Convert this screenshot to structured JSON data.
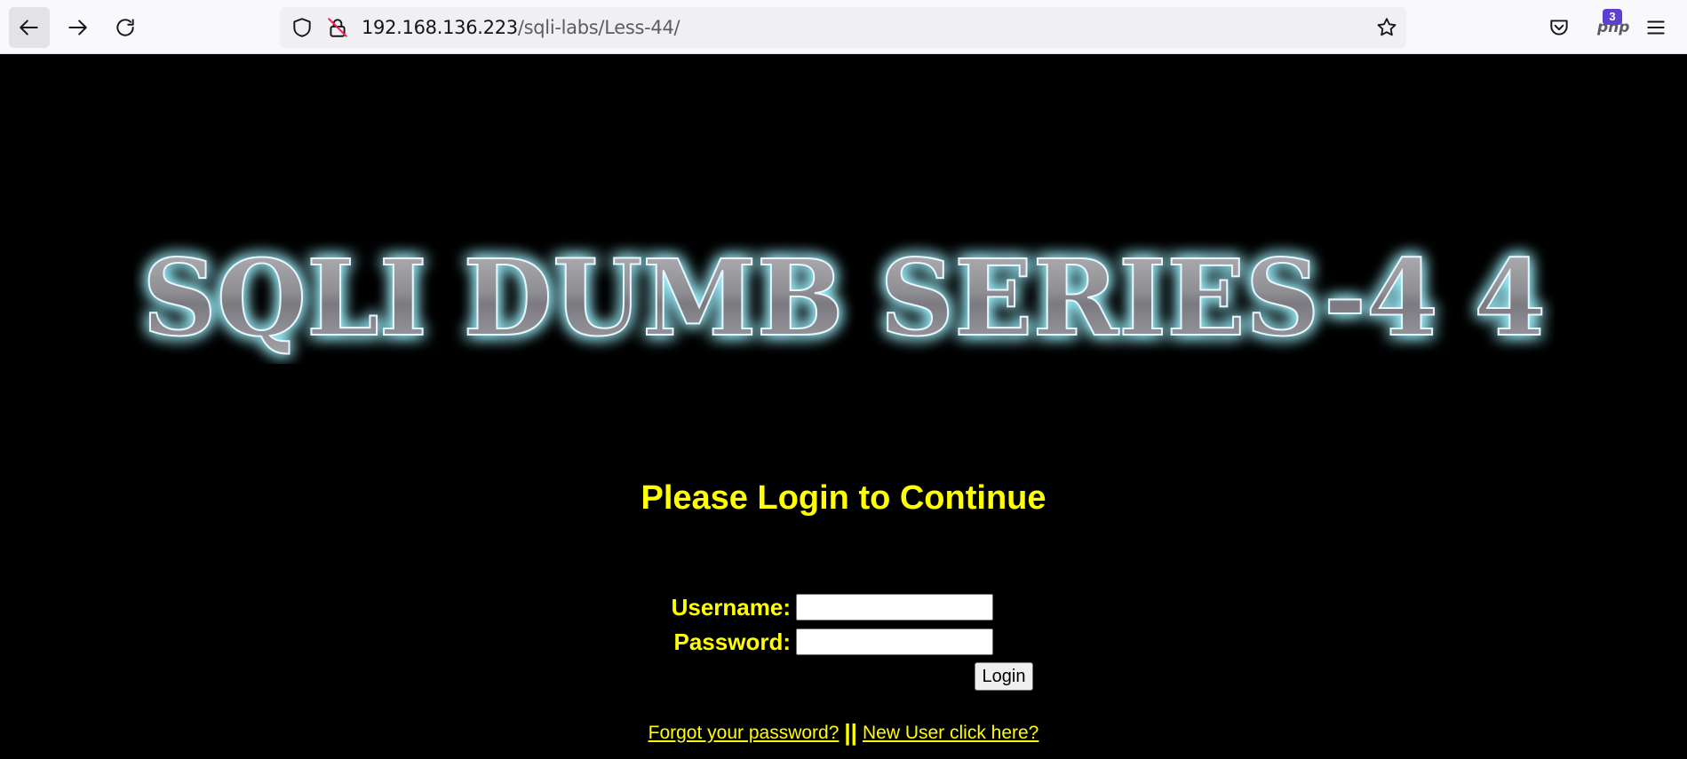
{
  "browser": {
    "url_host": "192.168.136.223",
    "url_path": "/sqli-labs/Less-44/",
    "extension_badge": "3",
    "extension_label": "php"
  },
  "page": {
    "banner_text": "SQLI DUMB SERIES-4 4",
    "heading": "Please Login to Continue",
    "username_label": "Username:",
    "password_label": "Password:",
    "username_value": "",
    "password_value": "",
    "login_label": "Login",
    "forgot_link": "Forgot your password?",
    "separator": "||",
    "new_user_link": "New User click here?"
  },
  "colors": {
    "page_background": "#000000",
    "text_accent": "#ffff00",
    "banner_glow": "#9ff3ff"
  }
}
